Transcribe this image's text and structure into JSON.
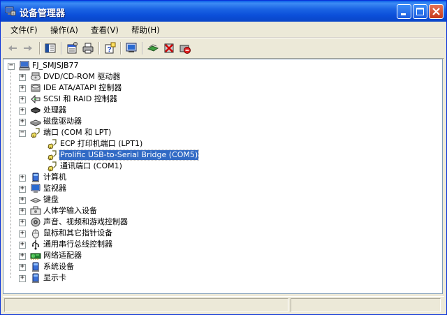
{
  "window": {
    "title": "设备管理器"
  },
  "titlebar_buttons": {
    "minimize": "minimize-icon",
    "maximize": "maximize-icon",
    "close": "close-icon"
  },
  "menu": [
    {
      "label": "文件(F)"
    },
    {
      "label": "操作(A)"
    },
    {
      "label": "查看(V)"
    },
    {
      "label": "帮助(H)"
    }
  ],
  "toolbar": [
    "back-icon",
    "forward-icon",
    "show-hide-tree-icon",
    "properties-icon",
    "print-icon",
    "help-icon",
    "scan-hardware-icon",
    "update-driver-icon",
    "uninstall-icon",
    "disable-icon"
  ],
  "tree": {
    "root": "FJ_SMJSJB77",
    "items": [
      {
        "label": "DVD/CD-ROM 驱动器",
        "icon": "dvd-drive-icon",
        "expanded": false
      },
      {
        "label": "IDE ATA/ATAPI 控制器",
        "icon": "ide-controller-icon",
        "expanded": false
      },
      {
        "label": "SCSI 和 RAID 控制器",
        "icon": "scsi-controller-icon",
        "expanded": false
      },
      {
        "label": "处理器",
        "icon": "processor-icon",
        "expanded": false
      },
      {
        "label": "磁盘驱动器",
        "icon": "disk-drive-icon",
        "expanded": false
      },
      {
        "label": "端口 (COM 和 LPT)",
        "icon": "port-icon",
        "expanded": true,
        "children": [
          {
            "label": "ECP 打印机端口 (LPT1)",
            "icon": "port-icon"
          },
          {
            "label": "Prolific USB-to-Serial Bridge (COM5)",
            "icon": "port-icon",
            "selected": true
          },
          {
            "label": "通讯端口 (COM1)",
            "icon": "port-icon"
          }
        ]
      },
      {
        "label": "计算机",
        "icon": "computer-icon",
        "expanded": false
      },
      {
        "label": "监视器",
        "icon": "monitor-icon",
        "expanded": false
      },
      {
        "label": "键盘",
        "icon": "keyboard-icon",
        "expanded": false
      },
      {
        "label": "人体学输入设备",
        "icon": "hid-icon",
        "expanded": false
      },
      {
        "label": "声音、视频和游戏控制器",
        "icon": "sound-icon",
        "expanded": false
      },
      {
        "label": "鼠标和其它指针设备",
        "icon": "mouse-icon",
        "expanded": false
      },
      {
        "label": "通用串行总线控制器",
        "icon": "usb-icon",
        "expanded": false
      },
      {
        "label": "网络适配器",
        "icon": "network-adapter-icon",
        "expanded": false
      },
      {
        "label": "系统设备",
        "icon": "system-device-icon",
        "expanded": false
      },
      {
        "label": "显示卡",
        "icon": "display-adapter-icon",
        "expanded": false
      }
    ]
  },
  "colors": {
    "titlebar": "#0b4fd9",
    "selection": "#316ac5",
    "window_bg": "#ece9d8"
  }
}
